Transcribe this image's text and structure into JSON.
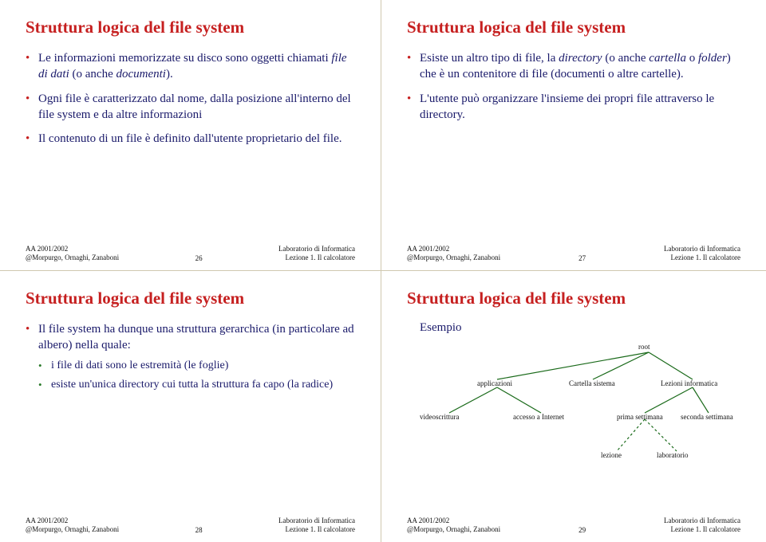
{
  "footer": {
    "left_l1": "AA 2001/2002",
    "left_l2": "@Morpurgo, Ornaghi, Zanaboni",
    "right_l1": "Laboratorio di Informatica",
    "right_l2": "Lezione 1. Il calcolatore"
  },
  "slides": [
    {
      "num": "26",
      "title": "Struttura logica del file system",
      "b1a": "Le informazioni memorizzate su disco sono oggetti chiamati ",
      "b1i": "file di dati",
      "b1b": " (o anche ",
      "b1i2": "documenti",
      "b1c": ").",
      "b2": "Ogni file è caratterizzato dal nome, dalla posizione all'interno del file system e da altre informazioni",
      "b3": "Il contenuto di un file è definito dall'utente proprietario del file."
    },
    {
      "num": "27",
      "title": "Struttura logica del file system",
      "b1a": "Esiste un altro tipo di file, la ",
      "b1i": "directory",
      "b1b": " (o anche ",
      "b1i2": "cartella",
      "b1c": " o ",
      "b1i3": "folder",
      "b1d": ") che è un contenitore di file (documenti o altre cartelle).",
      "b2": "L'utente può organizzare l'insieme dei propri file attraverso le directory."
    },
    {
      "num": "28",
      "title": "Struttura logica del file system",
      "b1": "Il file system ha dunque una struttura gerarchica (in particolare ad albero) nella quale:",
      "s1": "i file di dati sono le estremità (le foglie)",
      "s2": "esiste un'unica directory cui tutta la struttura fa capo (la radice)"
    },
    {
      "num": "29",
      "title": "Struttura logica del file system",
      "example": "Esempio",
      "nodes": {
        "root": "root",
        "app": "applicazioni",
        "sis": "Cartella sistema",
        "lez": "Lezioni informatica",
        "vid": "videoscrittura",
        "acc": "accesso a Internet",
        "ps": "prima settimana",
        "ss": "seconda settimana",
        "lezione": "lezione",
        "lab": "laboratorio"
      }
    }
  ]
}
